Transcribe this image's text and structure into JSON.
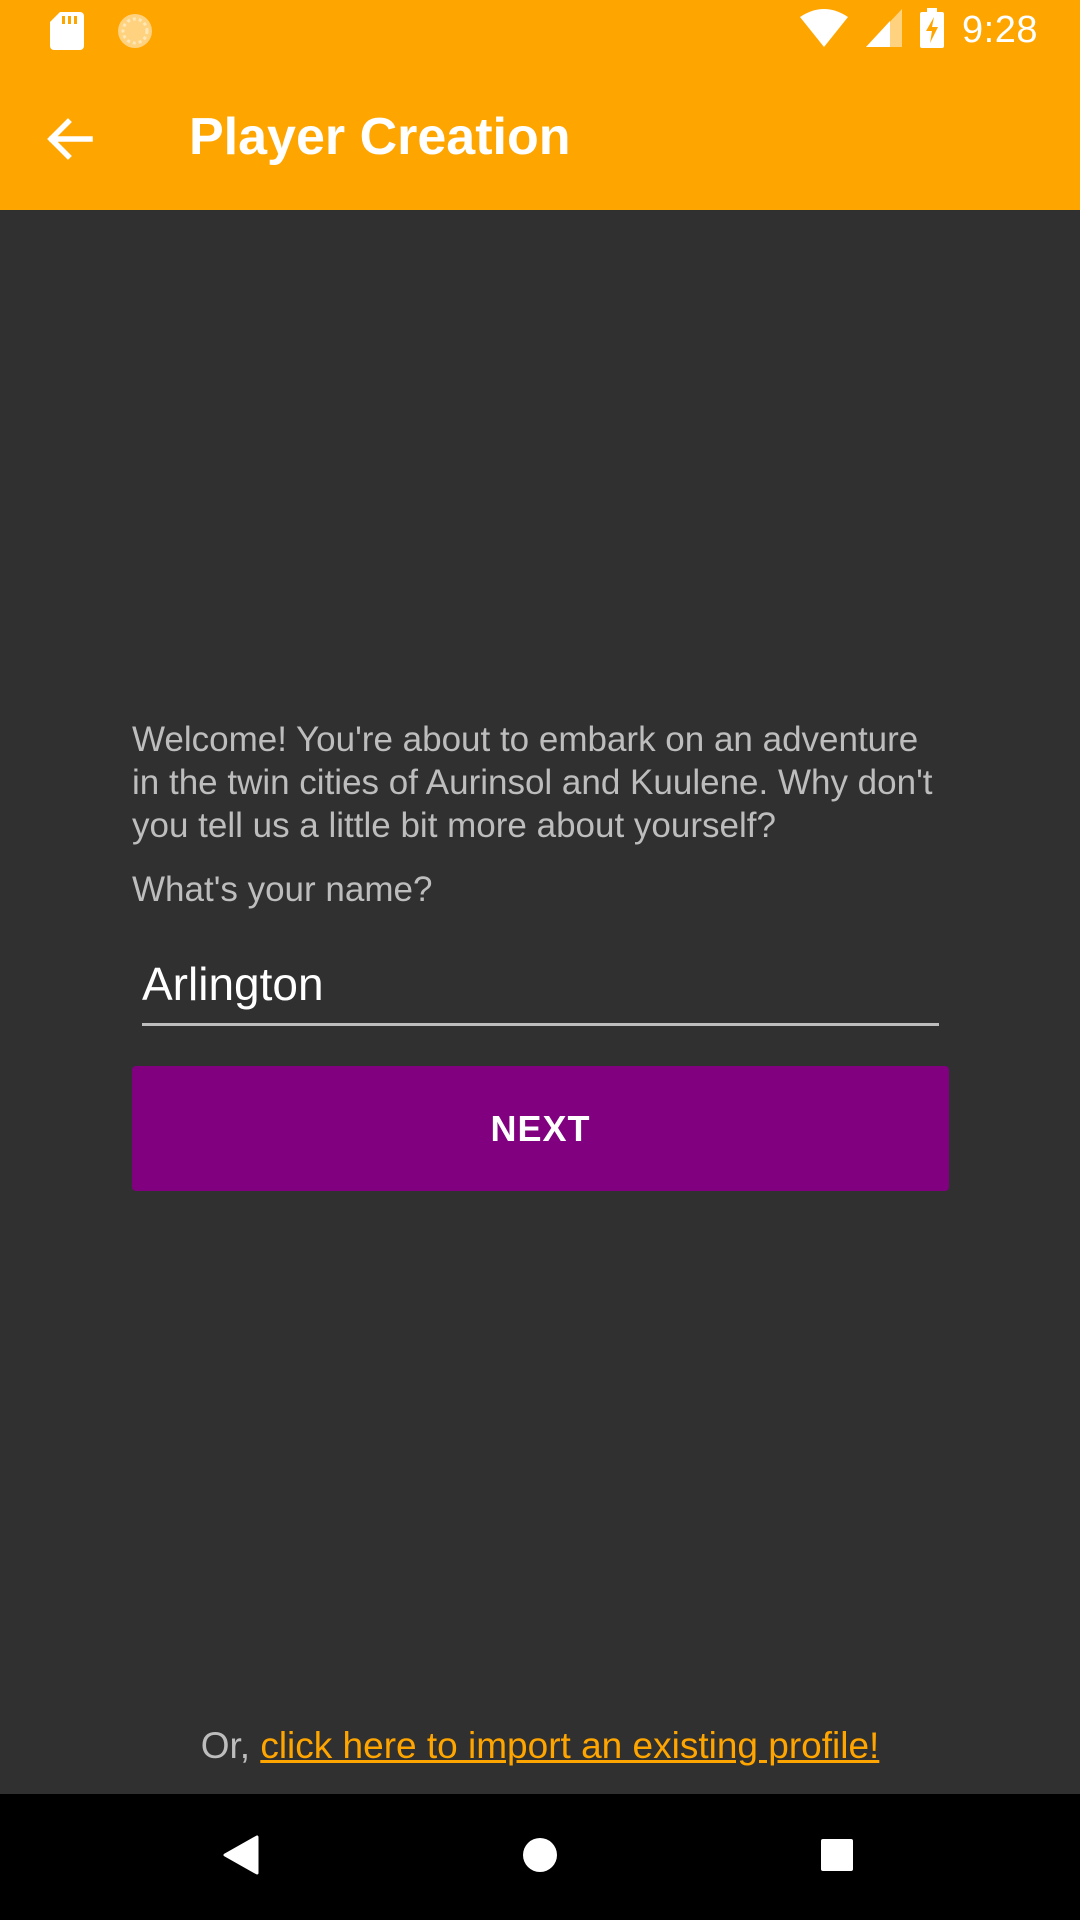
{
  "status_bar": {
    "time": "9:28",
    "icons": [
      "sd-card-icon",
      "sync-icon",
      "wifi-icon",
      "cell-signal-icon",
      "battery-charging-icon"
    ]
  },
  "app_bar": {
    "title": "Player Creation",
    "back_icon": "arrow-back-icon"
  },
  "content": {
    "welcome_text": "Welcome! You're about to embark on an adventure in the twin cities of Aurinsol and Kuulene. Why don't you tell us a little bit more about yourself?",
    "name_question": "What's your name?",
    "name_field": {
      "value": "Arlington",
      "placeholder": ""
    },
    "next_label": "NEXT",
    "import_prefix": "Or, ",
    "import_link": "click here to import an existing profile!"
  },
  "nav_bar": {
    "icons": [
      "back-triangle-icon",
      "home-circle-icon",
      "recents-square-icon"
    ]
  },
  "colors": {
    "accent": "#FFA500",
    "button": "#800080",
    "background": "#303030",
    "secondary_text": "#BDBDBD"
  }
}
